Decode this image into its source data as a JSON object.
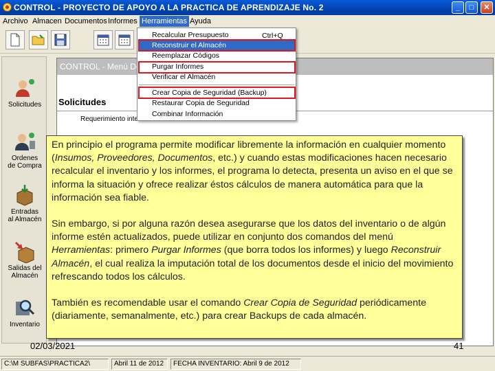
{
  "window": {
    "title": "CONTROL - PROYECTO DE APOYO A LA PRACTICA DE APRENDIZAJE No. 2",
    "min_symbol": "_",
    "max_symbol": "□",
    "close_symbol": "✕"
  },
  "menubar": [
    "Archivo",
    "Almacen",
    "Documentos",
    "Informes",
    "Herramientas",
    "Ayuda"
  ],
  "dropdown": {
    "items": [
      {
        "label": "Recalcular Presupuesto",
        "shortcut": "Ctrl+Q"
      },
      {
        "label": "Reconstruir el Almacén",
        "shortcut": ""
      },
      {
        "label": "Reemplazar Códigos",
        "shortcut": ""
      },
      {
        "label": "Purgar Informes",
        "shortcut": ""
      },
      {
        "label": "Verificar el Almacén",
        "shortcut": ""
      },
      {
        "label": "Crear Copia de Seguridad (Backup)",
        "shortcut": ""
      },
      {
        "label": "Restaurar Copia de Seguridad",
        "shortcut": ""
      },
      {
        "label": "Combinar Información",
        "shortcut": ""
      }
    ],
    "highlight_color": "#316ac5",
    "annotation_color": "#e0161c"
  },
  "sidebar": {
    "items": [
      {
        "label_1": "Solicitudes",
        "label_2": ""
      },
      {
        "label_1": "Ordenes",
        "label_2": "de Compra"
      },
      {
        "label_1": "Entradas",
        "label_2": "al Almacén"
      },
      {
        "label_1": "Salidas del",
        "label_2": "Almacén"
      },
      {
        "label_1": "Inventario",
        "label_2": ""
      }
    ]
  },
  "inner_window": {
    "title": "CONTROL - Menú De",
    "heading": "Solicitudes",
    "subheading": "Requerimiento interno de Insumos"
  },
  "note": {
    "p1": {
      "a": "En principio el programa permite modificar libremente la información en cualquier momento (",
      "b": "Insumos, Proveedores, Documentos",
      "c": ", etc.) y cuando estas modificaciones hacen necesario recalcular el inventario y los informes, el programa lo detecta, presenta un aviso en el que se informa la situación y ofrece realizar éstos cálculos de manera automática para que la información sea fiable."
    },
    "p2": {
      "a": "Sin embargo, si por alguna razón desea asegurarse que los datos del inventario o de algún informe estén actualizados, puede utilizar en conjunto dos comandos del menú ",
      "b": "Herramientas",
      "c": ": primero ",
      "d": "Purgar Informes",
      "e": " (que borra todos los informes) y luego ",
      "f": "Reconstruir Almacén",
      "g": ", el cual realiza la imputación total de los documentos desde el inicio del movimiento refrescando todos los cálculos."
    },
    "p3": {
      "a": "También es recomendable usar el comando ",
      "b": "Crear Copia de Seguridad",
      "c": " periódicamente (diariamente, semanalmente, etc.) para crear Backups de cada almacén."
    },
    "background": "#ffff99"
  },
  "footer": {
    "date": "02/03/2021",
    "page": "41"
  },
  "statusbar": {
    "path": "C:\\M SUBFAS\\PRACTICA2\\",
    "date": "Abril 11 de 2012",
    "inventory": "FECHA INVENTARIO: Abril 9 de 2012"
  }
}
